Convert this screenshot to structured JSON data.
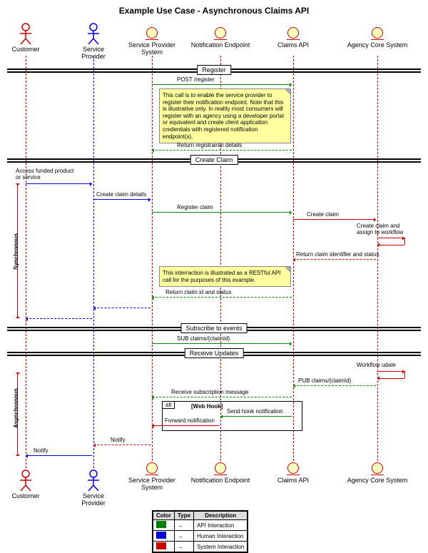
{
  "title": "Example Use Case - Asynchronous Claims API",
  "participants": {
    "customer": "Customer",
    "provider": "Service Provider",
    "spsystem": "Service Provider System",
    "notif": "Notification Endpoint",
    "claims": "Claims API",
    "agency": "Agency Core System"
  },
  "sections": {
    "register": "Register",
    "create": "Create Claim",
    "subscribe": "Subscribe to events",
    "receive": "Receive Updates"
  },
  "notes": {
    "reg": "This call is to enable the service provider to register their notification endpoint. Note that this is illustrative only. In reality most consumers will register with an agency using a developer portal or equivalent and create client application credentials with registered notification endpoint(s).",
    "rest": "This interraction is illustrated as a RESTful API call for the purposes of this example."
  },
  "messages": {
    "m1": "POST /register",
    "m2": "Return registraiotn details",
    "m3": "Access funded product or service",
    "m4": "Create claim details",
    "m5": "Register claim",
    "m6": "Create claim",
    "m7": "Create claim and assign to workflow",
    "m8": "Return claim identifier and status",
    "m9": "Return claim id and status",
    "m10": "SUB claims/{claimId}",
    "m11": "Workflow udate",
    "m12": "PUB claims/{claimId}",
    "m13": "Receive subscription message",
    "m14": "Send hook notification",
    "m15": "Forward notification",
    "m16": "Notify",
    "m17": "Notify"
  },
  "alt": {
    "label": "alt",
    "cond": "[Web Hook]"
  },
  "syncLabels": {
    "sync": "Synchronous",
    "async": "Asynchronous"
  },
  "legend": {
    "hColor": "Color",
    "hType": "Type",
    "hDesc": "Description",
    "r1": "API Interaction",
    "r2": "Human Interaction",
    "r3": "System Interaction",
    "c1": "#008000",
    "c2": "#0000dd",
    "c3": "#cc0000"
  }
}
